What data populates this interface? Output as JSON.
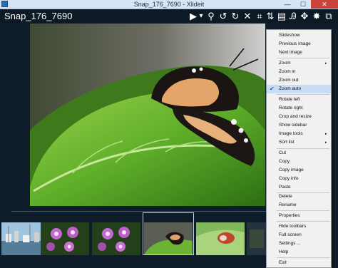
{
  "window": {
    "title": "Snap_176_7690 - Xlideit",
    "minimize_glyph": "—",
    "maximize_glyph": "☐",
    "close_glyph": "✕"
  },
  "toolbar": {
    "file_name": "Snap_176_7690",
    "icons": [
      "play-icon",
      "dropdown-arrow-icon",
      "zoom-icon",
      "rotate-left-icon",
      "rotate-right-icon",
      "delete-icon",
      "crop-icon",
      "sort-icon",
      "document-icon",
      "text-icon",
      "move-icon",
      "settings-icon",
      "fullscreen-icon"
    ],
    "glyphs": {
      "play": "▶",
      "dropdown": "▾",
      "zoom": "⚲",
      "rotate_left": "↺",
      "rotate_right": "↻",
      "delete": "✕",
      "crop": "⌗",
      "sort": "⇅",
      "document": "▤",
      "text": "Ꭿ",
      "move": "✥",
      "settings": "✸",
      "fullscreen": "⧉"
    }
  },
  "colors": {
    "window_bg": "#0e1b29",
    "menu_bg": "#f1f1f1",
    "highlight": "#c8ddf5",
    "close_red": "#c9433b"
  },
  "context_menu": {
    "items": [
      {
        "label": "Slideshow"
      },
      {
        "label": "Previous image"
      },
      {
        "label": "Next image"
      },
      {
        "label": "Zoom",
        "submenu": true
      },
      {
        "label": "Zoom in"
      },
      {
        "label": "Zoom out"
      },
      {
        "label": "Zoom auto",
        "checked": true
      },
      {
        "label": "Rotate left"
      },
      {
        "label": "Rotate right"
      },
      {
        "label": "Crop and resize"
      },
      {
        "label": "Show sidebar"
      },
      {
        "label": "Image tools",
        "submenu": true
      },
      {
        "label": "Sort list",
        "submenu": true
      },
      {
        "label": "Cut"
      },
      {
        "label": "Copy"
      },
      {
        "label": "Copy image"
      },
      {
        "label": "Copy info"
      },
      {
        "label": "Paste"
      },
      {
        "label": "Delete"
      },
      {
        "label": "Rename"
      },
      {
        "label": "Properties"
      },
      {
        "label": "Hide toolbars"
      },
      {
        "label": "Full screen"
      },
      {
        "label": "Settings ..."
      },
      {
        "label": "Help"
      },
      {
        "label": "Exit"
      }
    ],
    "submenu_glyph": "▸",
    "check_glyph": "✔"
  },
  "filmstrip": {
    "thumbnails": [
      {
        "subject": "harbor"
      },
      {
        "subject": "purple-flowers"
      },
      {
        "subject": "purple-flowers"
      },
      {
        "subject": "butterfly-on-leaf",
        "selected": true
      },
      {
        "subject": "red-insect-on-leaf"
      },
      {
        "subject": "dark-partial"
      }
    ]
  }
}
